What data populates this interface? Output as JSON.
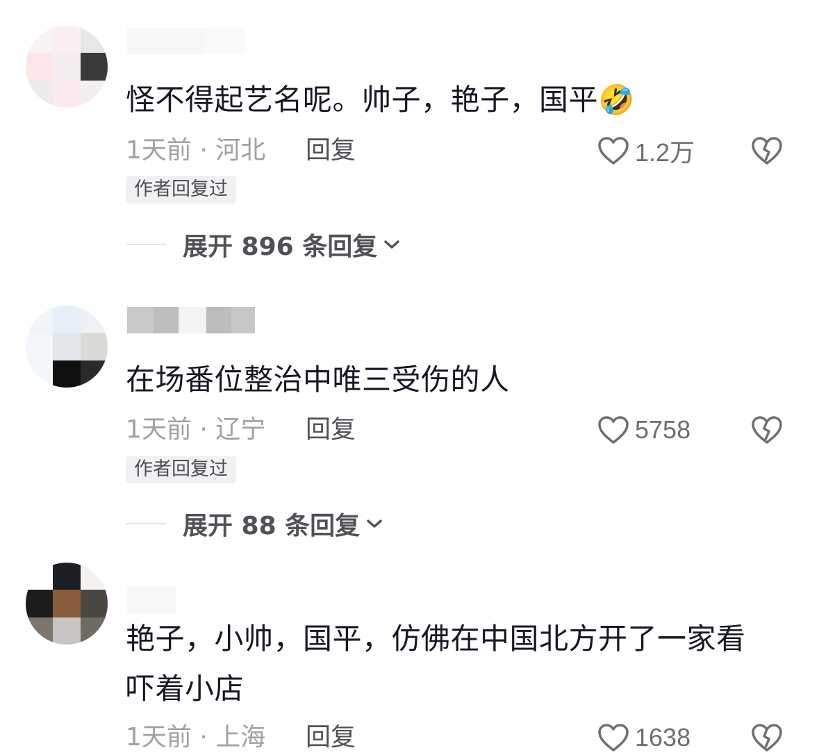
{
  "comments": [
    {
      "text": "怪不得起艺名呢。帅子，艳子，国平",
      "emoji": "🤣",
      "time_location": "1天前 · 河北",
      "reply_label": "回复",
      "likes": "1.2万",
      "tag": "作者回复过",
      "expand_label": "展开 896 条回复"
    },
    {
      "text": "在场番位整治中唯三受伤的人",
      "time_location": "1天前 · 辽宁",
      "reply_label": "回复",
      "likes": "5758",
      "tag": "作者回复过",
      "expand_label": "展开 88 条回复"
    },
    {
      "text_line1": "艳子，小帅，国平，仿佛在中国北方开了一家看",
      "text_line2": "吓着小店",
      "time_location": "1天前 · 上海",
      "reply_label": "回复",
      "likes": "1638"
    }
  ],
  "icons": {
    "like": "heart-outline-icon",
    "dislike": "broken-heart-icon",
    "expand": "chevron-down-icon"
  },
  "colors": {
    "text": "#161823",
    "meta": "#a0a0a5",
    "tag_bg": "#f1f1f3"
  }
}
